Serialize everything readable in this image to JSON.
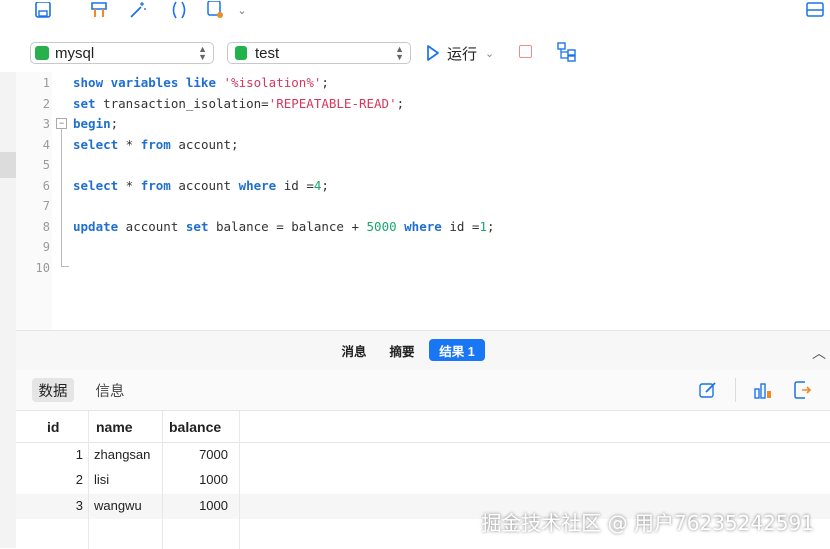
{
  "toolbar": {
    "icons": [
      "save-icon",
      "tag-icon",
      "magic-wand-icon",
      "parentheses-icon",
      "export-icon",
      "chevron-down-icon",
      "panel-layout-icon"
    ]
  },
  "connection": {
    "db_type": "mysql",
    "database": "test",
    "run_label": "运行"
  },
  "editor": {
    "line_numbers": [
      "1",
      "2",
      "3",
      "4",
      "5",
      "6",
      "7",
      "8",
      "9",
      "10"
    ]
  },
  "bottom_tabs": [
    {
      "label": "消息",
      "active": false
    },
    {
      "label": "摘要",
      "active": false
    },
    {
      "label": "结果 1",
      "active": true
    }
  ],
  "result_tabs": [
    {
      "label": "数据",
      "active": true
    },
    {
      "label": "信息",
      "active": false
    }
  ],
  "table": {
    "columns": [
      "id",
      "name",
      "balance"
    ],
    "rows": [
      [
        "1",
        "zhangsan",
        "7000"
      ],
      [
        "2",
        "lisi",
        "1000"
      ],
      [
        "3",
        "wangwu",
        "1000"
      ]
    ]
  },
  "watermark": "掘金技术社区 @ 用户76235242591",
  "colors": {
    "accent": "#1976f5",
    "keyword": "#1f6fd1",
    "string": "#d8365d",
    "number": "#1aa86b"
  }
}
